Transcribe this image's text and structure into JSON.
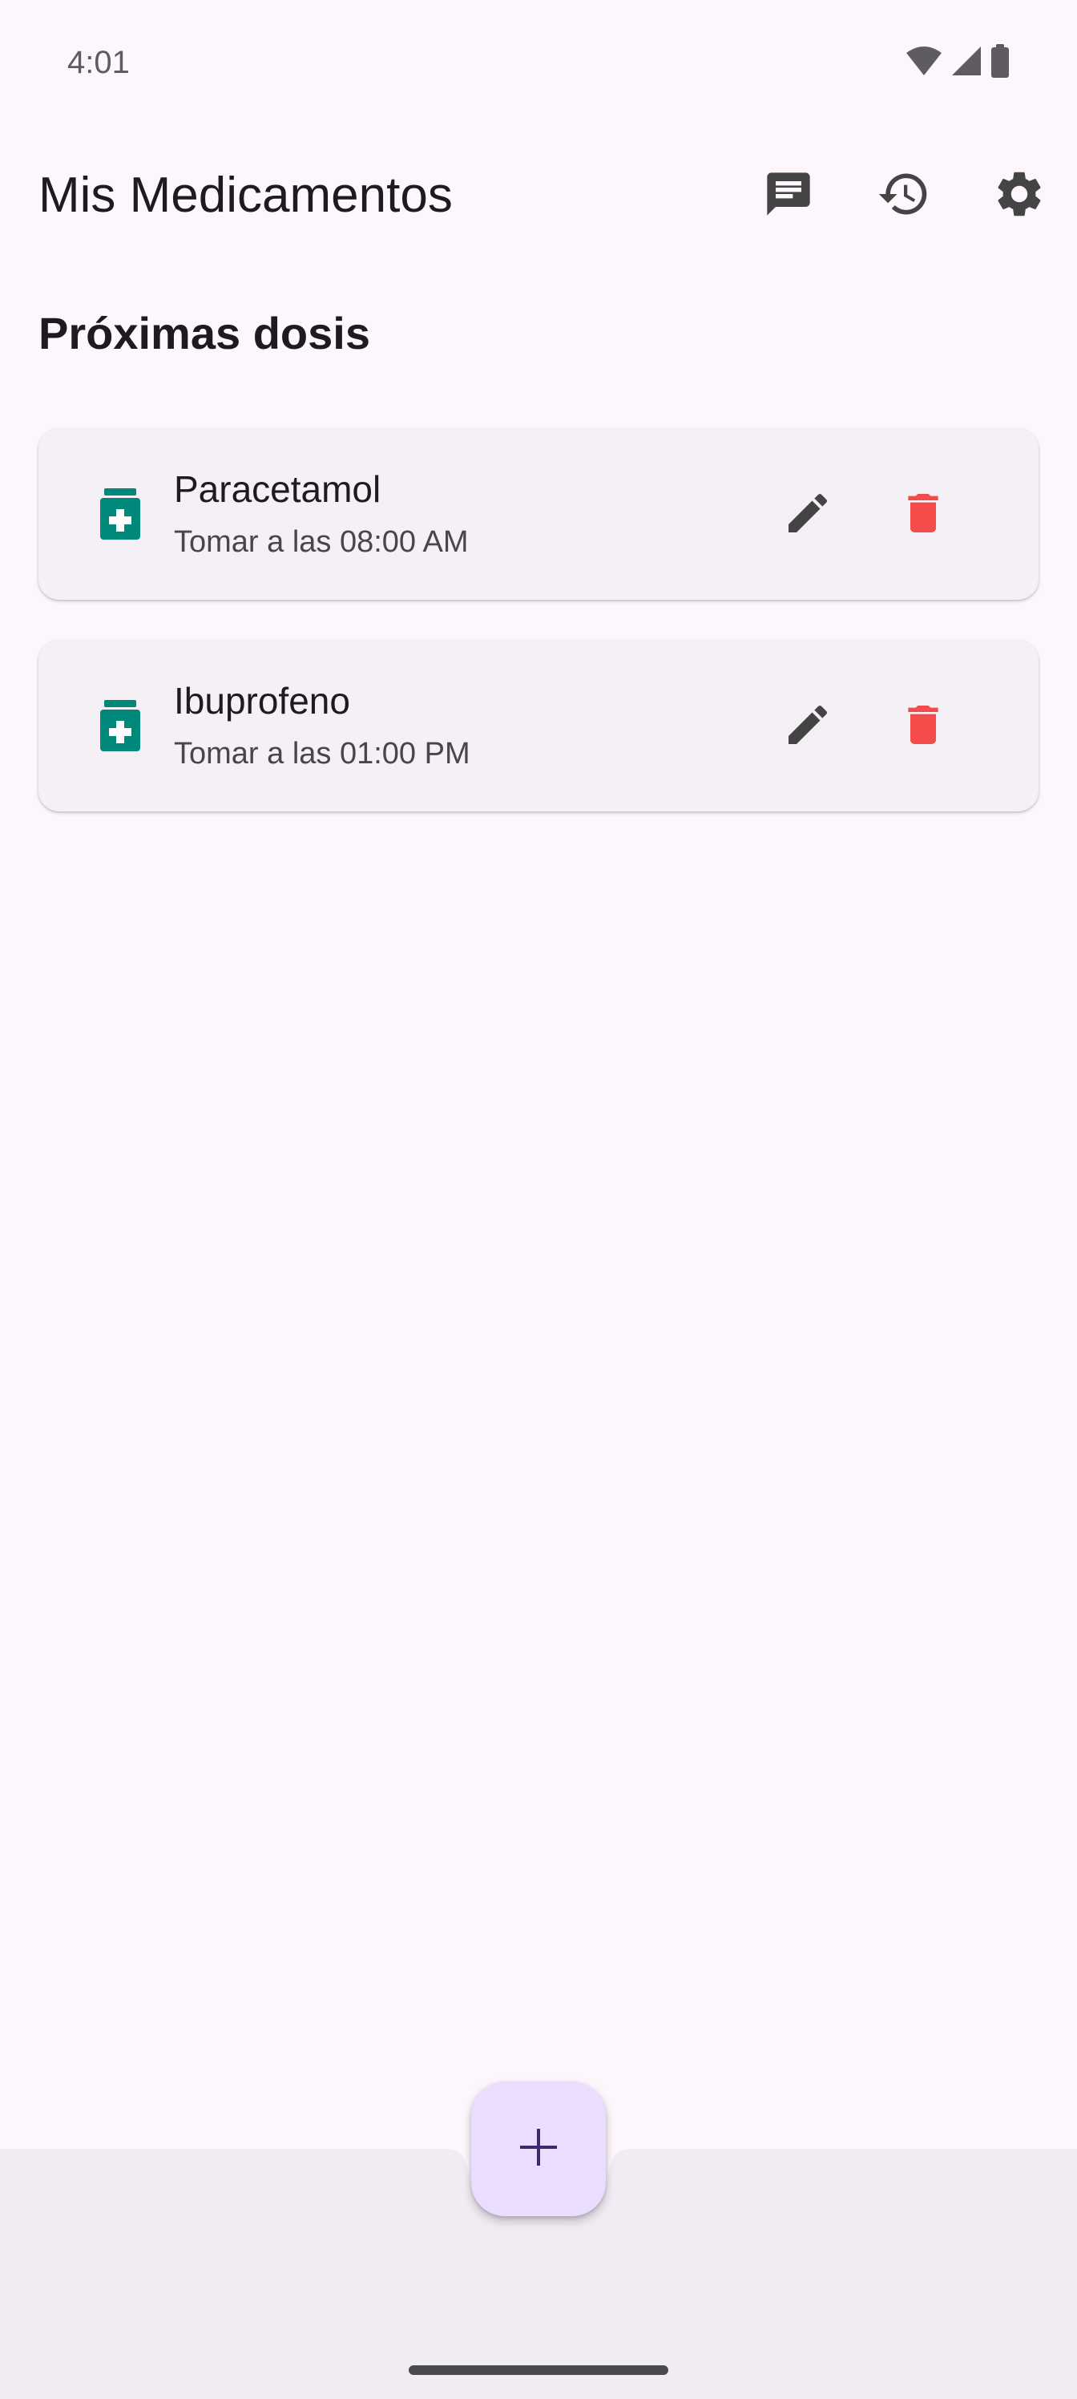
{
  "status_bar": {
    "time": "4:01",
    "icons": [
      "wifi-icon",
      "cellular-signal-icon",
      "battery-icon"
    ]
  },
  "app_bar": {
    "title": "Mis Medicamentos",
    "actions": [
      "chat-icon",
      "history-icon",
      "settings-icon"
    ]
  },
  "section": {
    "title": "Próximas dosis"
  },
  "medications": [
    {
      "name": "Paracetamol",
      "schedule": "Tomar a las 08:00 AM",
      "icon": "medication-bottle-icon"
    },
    {
      "name": "Ibuprofeno",
      "schedule": "Tomar a las 01:00 PM",
      "icon": "medication-bottle-icon"
    }
  ],
  "card_actions": [
    "edit-icon",
    "delete-icon"
  ],
  "fab": {
    "icon": "plus-icon"
  },
  "colors": {
    "background": "#FDF7FD",
    "card": "#F4F0F5",
    "bottom_bar": "#F1ECF4",
    "medication_icon": "#00897B",
    "delete_icon": "#F44B4B",
    "action_icon": "#444444",
    "fab": "#EADDFF",
    "fab_icon": "#3E2A6B"
  }
}
